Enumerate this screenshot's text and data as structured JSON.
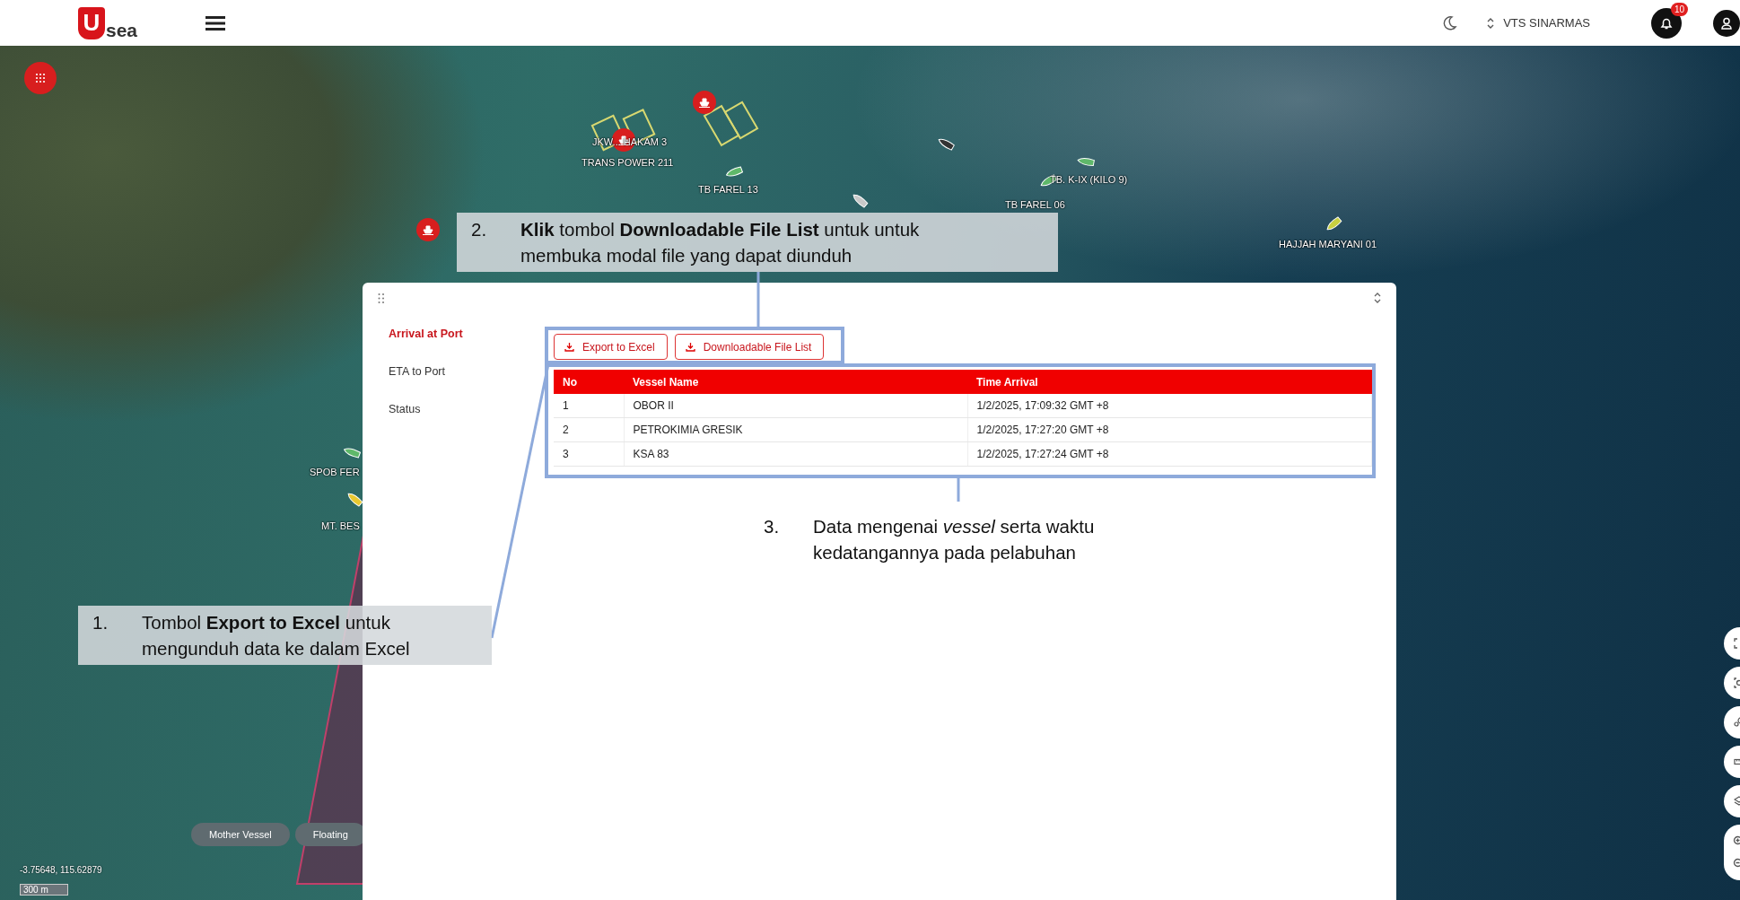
{
  "topbar": {
    "logo_mark": "U",
    "logo_text": "sea",
    "account": "VTS SINARMAS",
    "notification_count": "10"
  },
  "map": {
    "vessel_labels": [
      "JKW... HAKAM 3",
      "TRANS POWER 211",
      "TB FAREL 13",
      "TB. K-IX (KILO 9)",
      "TB FAREL 06",
      "HAJJAH MARYANI 01",
      "SPOB FER",
      "MT. BES"
    ],
    "filter_chips": [
      "Mother Vessel",
      "Floating"
    ],
    "coordinates": "-3.75648, 115.62879",
    "scale": "300 m"
  },
  "panel": {
    "menu": [
      {
        "label": "Arrival at Port",
        "selected": true
      },
      {
        "label": "ETA to Port",
        "selected": false
      },
      {
        "label": "Status",
        "selected": false
      }
    ],
    "buttons": [
      "Export to Excel",
      "Downloadable File List"
    ],
    "table": {
      "columns": [
        "No",
        "Vessel Name",
        "Time Arrival"
      ],
      "rows": [
        [
          "1",
          "OBOR II",
          "1/2/2025, 17:09:32 GMT +8"
        ],
        [
          "2",
          "PETROKIMIA GRESIK",
          "1/2/2025, 17:27:20 GMT +8"
        ],
        [
          "3",
          "KSA 83",
          "1/2/2025, 17:27:24 GMT +8"
        ]
      ]
    }
  },
  "annotations": [
    {
      "number": "1.",
      "text": "Tombol **Export to Excel** untuk mengunduh data ke dalam Excel"
    },
    {
      "number": "2.",
      "text": "**Klik** tombol **Downloadable File List** untuk untuk membuka modal file yang dapat diunduh"
    },
    {
      "number": "3.",
      "text": "Data mengenai *vessel* serta waktu kedatangannya pada pelabuhan"
    }
  ]
}
